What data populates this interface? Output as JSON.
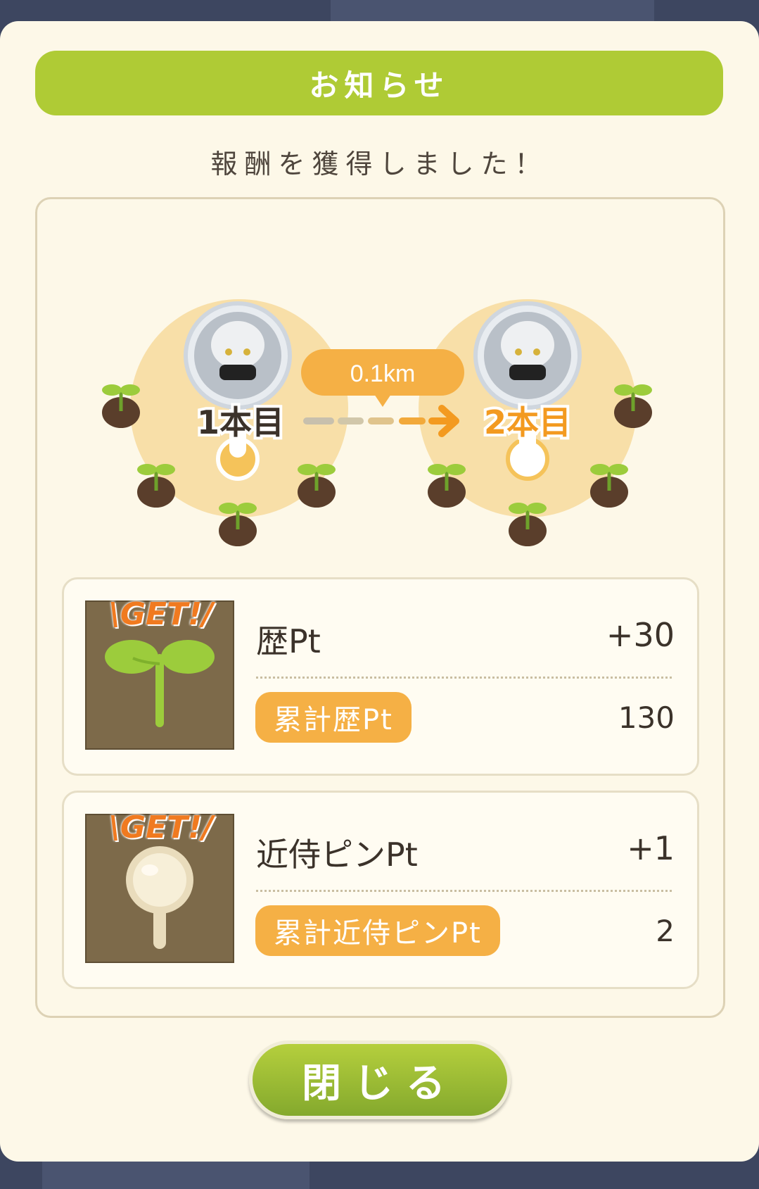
{
  "header": {
    "title": "お知らせ"
  },
  "subtitle": "報酬を獲得しました！",
  "map": {
    "distance": "0.1km",
    "from_label": "1本目",
    "to_label": "2本目"
  },
  "rewards": [
    {
      "badge": "\\GET!/",
      "icon": "sprout-icon",
      "name": "歴Pt",
      "amount": "+30",
      "total_label": "累計歴Pt",
      "total_value": "130"
    },
    {
      "badge": "\\GET!/",
      "icon": "magnifier-pin-icon",
      "name": "近侍ピンPt",
      "amount": "+1",
      "total_label": "累計近侍ピンPt",
      "total_value": "2"
    }
  ],
  "close_button": {
    "label": "閉じる"
  },
  "colors": {
    "header_green": "#afcb35",
    "accent_orange": "#f5b045",
    "modal_bg": "#fdf8e8"
  }
}
